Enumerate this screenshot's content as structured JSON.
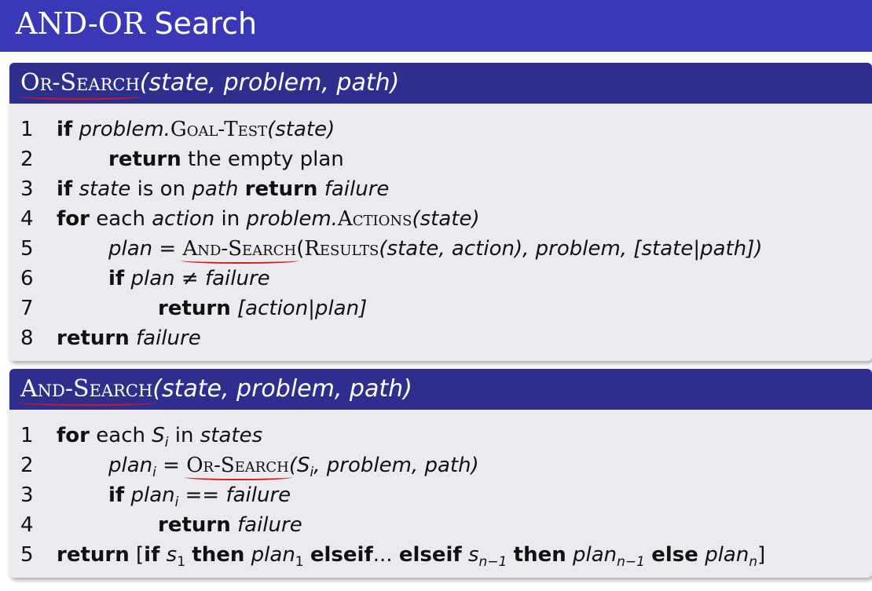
{
  "slide": {
    "title_part1": "AND-OR",
    "title_part2": " Search"
  },
  "or_search": {
    "name": "Or-Search",
    "params": "(state, problem, path)",
    "lines": [
      {
        "num": "1"
      },
      {
        "num": "2"
      },
      {
        "num": "3"
      },
      {
        "num": "4"
      },
      {
        "num": "5"
      },
      {
        "num": "6"
      },
      {
        "num": "7"
      },
      {
        "num": "8"
      }
    ],
    "kw_if": "if",
    "kw_return": "return",
    "kw_for": "for",
    "kw_then": "then",
    "kw_else": "else",
    "kw_elseif": "elseif",
    "l1_problem": "problem.",
    "l1_goal": "Goal-Test",
    "l1_arg": "(state)",
    "l2_rest": " the empty plan",
    "l3_state": " state",
    "l3_mid": " is on ",
    "l3_path": "path",
    "l3_failure": " failure",
    "l4_each": " each ",
    "l4_action": "action",
    "l4_in": " in ",
    "l4_problem": "problem.",
    "l4_actions": "Actions",
    "l4_arg": "(state)",
    "l5_plan": "plan",
    "l5_eq": " = ",
    "l5_and": "And-Search",
    "l5_open": "(",
    "l5_results": "Results",
    "l5_args": "(state, action), problem, [state|path])",
    "l6_cond": " plan ≠ failure",
    "l7_ret": " [action|plan]",
    "l8_fail": " failure"
  },
  "and_search": {
    "name": "And-Search",
    "params": "(state, problem, path)",
    "lines": [
      {
        "num": "1"
      },
      {
        "num": "2"
      },
      {
        "num": "3"
      },
      {
        "num": "4"
      },
      {
        "num": "5"
      }
    ],
    "l1_each": " each ",
    "l1_s": "S",
    "l1_sub": "i",
    "l1_in": " in ",
    "l1_states": "states",
    "l2_plan": "plan",
    "l2_sub": "i",
    "l2_eq": " = ",
    "l2_or": "Or-Search",
    "l2_s": "(S",
    "l2_ssub": "i",
    "l2_rest": ", problem, path)",
    "l3_plan": " plan",
    "l3_sub": "i",
    "l3_cond": " == failure",
    "l4_fail": " failure",
    "l5_open": " [",
    "l5_s1": "s",
    "l5_s1sub": "1",
    "l5_plan1": "plan",
    "l5_plan1sub": "1",
    "l5_dots": "...",
    "l5_sn": "s",
    "l5_snsub": "n−1",
    "l5_plann1": "plan",
    "l5_plann1sub": "n−1",
    "l5_plann": "plan",
    "l5_plannsub": "n",
    "l5_close": "]"
  },
  "colors": {
    "header_bg": "#3939b8",
    "block_title_bg": "#2e2e8f",
    "block_body_bg": "#eaeaef",
    "annotation_red": "#d21a1a"
  }
}
